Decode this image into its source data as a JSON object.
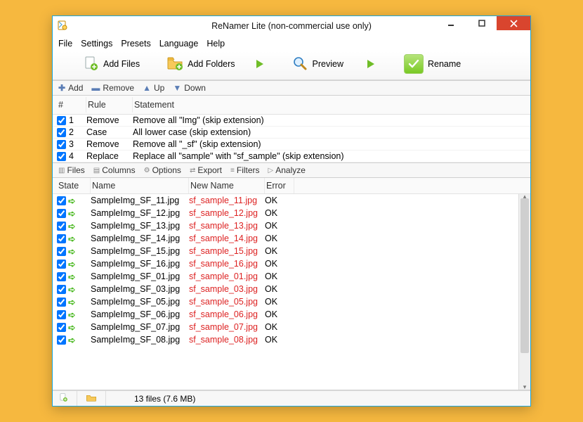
{
  "window": {
    "title": "ReNamer Lite (non-commercial use only)"
  },
  "menu": {
    "items": [
      "File",
      "Settings",
      "Presets",
      "Language",
      "Help"
    ]
  },
  "main_toolbar": {
    "add_files": "Add Files",
    "add_folders": "Add Folders",
    "preview": "Preview",
    "rename": "Rename"
  },
  "rules_toolbar": {
    "add": "Add",
    "remove": "Remove",
    "up": "Up",
    "down": "Down"
  },
  "rules": {
    "headers": {
      "num": "#",
      "rule": "Rule",
      "statement": "Statement"
    },
    "rows": [
      {
        "n": "1",
        "rule": "Remove",
        "stmt": "Remove all \"Img\" (skip extension)"
      },
      {
        "n": "2",
        "rule": "Case",
        "stmt": "All lower case (skip extension)"
      },
      {
        "n": "3",
        "rule": "Remove",
        "stmt": "Remove all \"_sf\" (skip extension)"
      },
      {
        "n": "4",
        "rule": "Replace",
        "stmt": "Replace all \"sample\" with \"sf_sample\" (skip extension)"
      }
    ]
  },
  "files_toolbar": {
    "files": "Files",
    "columns": "Columns",
    "options": "Options",
    "export": "Export",
    "filters": "Filters",
    "analyze": "Analyze"
  },
  "files": {
    "headers": {
      "state": "State",
      "name": "Name",
      "newname": "New Name",
      "error": "Error"
    },
    "rows": [
      {
        "name": "SampleImg_SF_11.jpg",
        "new": "sf_sample_11.jpg",
        "err": "OK"
      },
      {
        "name": "SampleImg_SF_12.jpg",
        "new": "sf_sample_12.jpg",
        "err": "OK"
      },
      {
        "name": "SampleImg_SF_13.jpg",
        "new": "sf_sample_13.jpg",
        "err": "OK"
      },
      {
        "name": "SampleImg_SF_14.jpg",
        "new": "sf_sample_14.jpg",
        "err": "OK"
      },
      {
        "name": "SampleImg_SF_15.jpg",
        "new": "sf_sample_15.jpg",
        "err": "OK"
      },
      {
        "name": "SampleImg_SF_16.jpg",
        "new": "sf_sample_16.jpg",
        "err": "OK"
      },
      {
        "name": "SampleImg_SF_01.jpg",
        "new": "sf_sample_01.jpg",
        "err": "OK"
      },
      {
        "name": "SampleImg_SF_03.jpg",
        "new": "sf_sample_03.jpg",
        "err": "OK"
      },
      {
        "name": "SampleImg_SF_05.jpg",
        "new": "sf_sample_05.jpg",
        "err": "OK"
      },
      {
        "name": "SampleImg_SF_06.jpg",
        "new": "sf_sample_06.jpg",
        "err": "OK"
      },
      {
        "name": "SampleImg_SF_07.jpg",
        "new": "sf_sample_07.jpg",
        "err": "OK"
      },
      {
        "name": "SampleImg_SF_08.jpg",
        "new": "sf_sample_08.jpg",
        "err": "OK"
      }
    ]
  },
  "status": {
    "text": "13 files (7.6 MB)"
  }
}
